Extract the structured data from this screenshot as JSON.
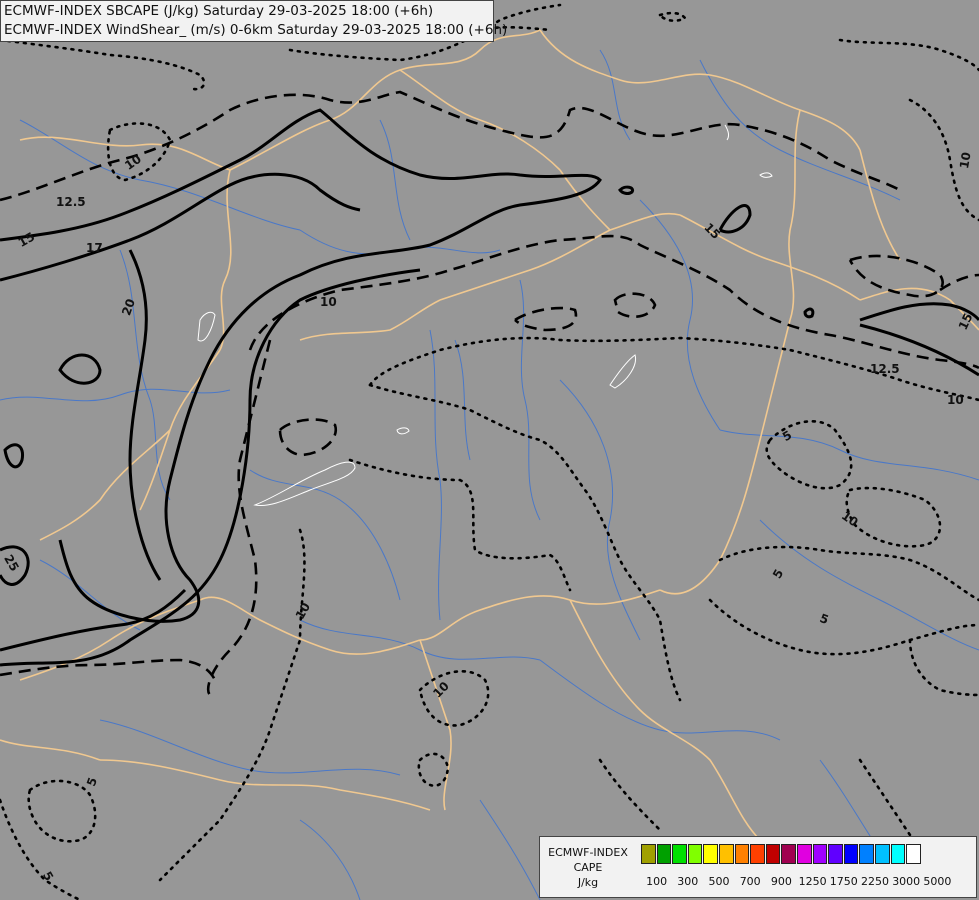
{
  "title": {
    "line1": "ECMWF-INDEX SBCAPE (J/kg) Saturday 29-03-2025 18:00 (+6h)",
    "line2": "ECMWF-INDEX WindShear_ (m/s) 0-6km Saturday 29-03-2025 18:00 (+6h)"
  },
  "legend": {
    "line1": "ECMWF-INDEX",
    "line2": "CAPE",
    "line3": "J/kg",
    "colors": [
      "#999999",
      "#a0a000",
      "#00a000",
      "#00e000",
      "#80ff00",
      "#ffff00",
      "#ffc000",
      "#ff8000",
      "#ff4000",
      "#c00000",
      "#a00050",
      "#e000e0",
      "#a000ff",
      "#6000ff",
      "#0000ff",
      "#0080ff",
      "#00c0ff",
      "#00ffff",
      "#ffffff"
    ],
    "ticks": [
      "100",
      "300",
      "500",
      "700",
      "900",
      "1250",
      "1750",
      "2250",
      "3000",
      "5000"
    ]
  },
  "contour_labels": [
    "10",
    "12.5",
    "15",
    "17",
    "20",
    "10",
    "15",
    "10",
    "12.5",
    "10",
    "15",
    "5",
    "10",
    "5",
    "5",
    "10",
    "10",
    "5",
    "5",
    "25"
  ],
  "map_colors": {
    "background": "#979797",
    "borders": "#f0c890",
    "rivers": "#4a78c8",
    "contours": "#000000",
    "lakes": "#ffffff"
  }
}
